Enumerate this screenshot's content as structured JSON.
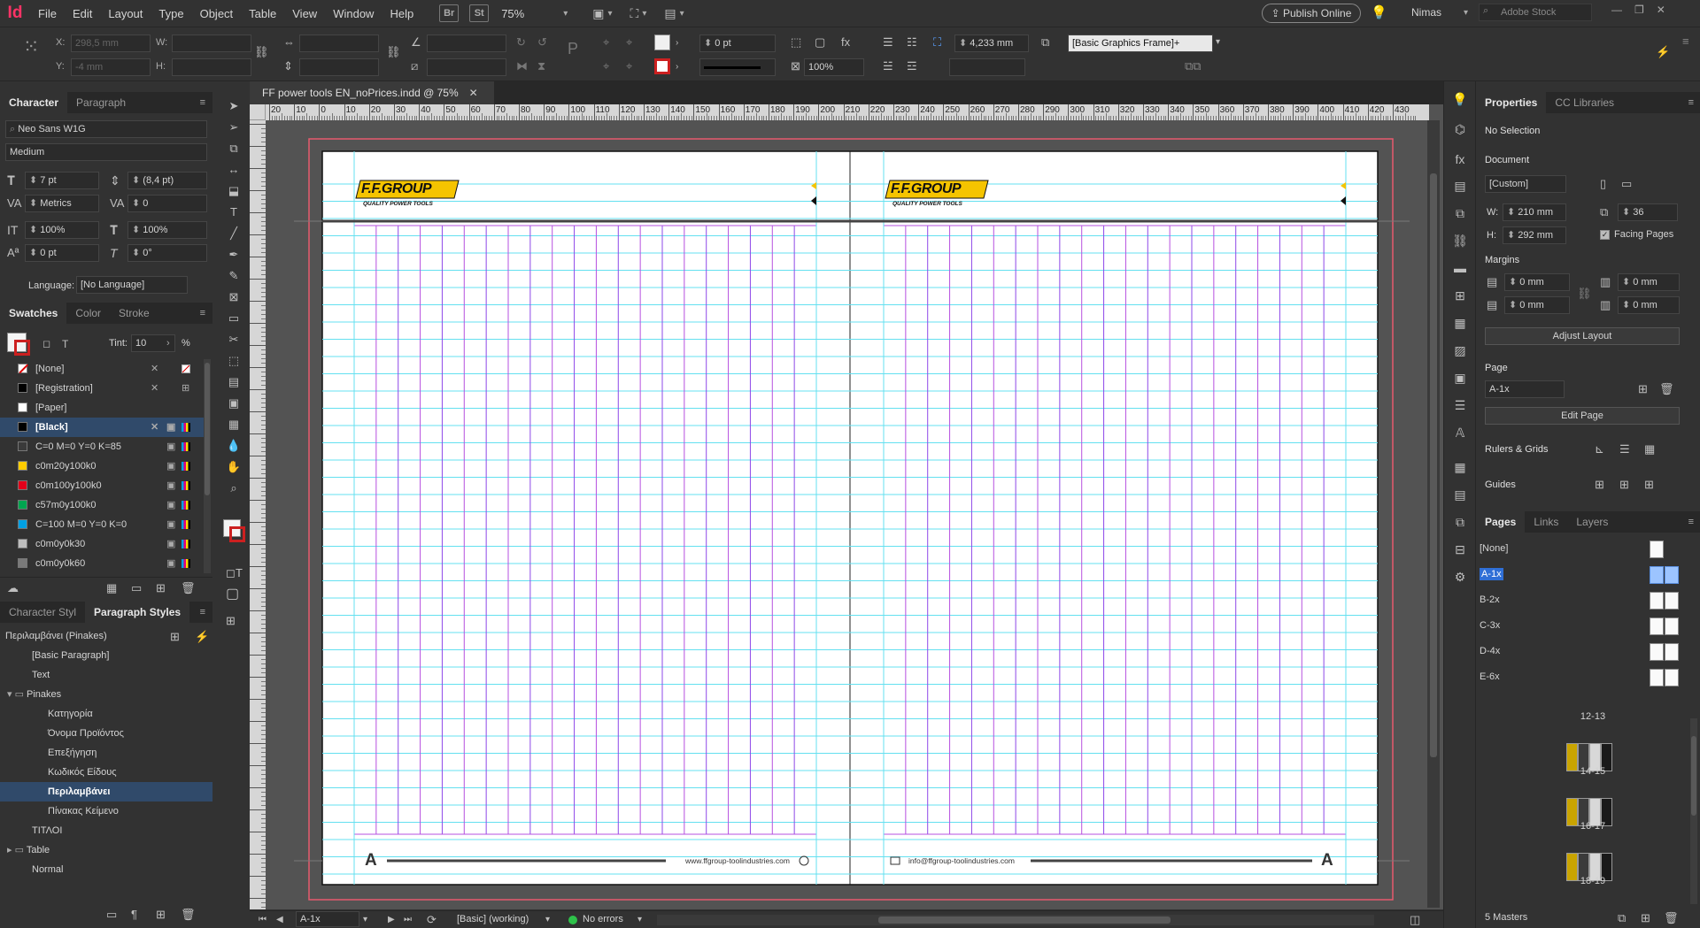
{
  "menu": {
    "app_logo": "Id",
    "items": [
      "File",
      "Edit",
      "Layout",
      "Type",
      "Object",
      "Table",
      "View",
      "Window",
      "Help"
    ],
    "bridge": "Br",
    "stock_app": "St",
    "zoom": "75%",
    "publish": "Publish Online",
    "user": "Nimas",
    "search_placeholder": "Adobe Stock"
  },
  "control": {
    "x_label": "X:",
    "x_value": "298,5 mm",
    "y_label": "Y:",
    "y_value": "-4 mm",
    "w_label": "W:",
    "h_label": "H:",
    "stroke_weight": "0 pt",
    "scale_pct": "100%",
    "frame_dim": "4,233 mm",
    "object_style": "[Basic Graphics Frame]+"
  },
  "character_panel": {
    "tabs": [
      "Character",
      "Paragraph"
    ],
    "font_family": "Neo Sans W1G",
    "font_style": "Medium",
    "size": "7 pt",
    "leading": "(8,4 pt)",
    "kerning": "Metrics",
    "tracking": "0",
    "vscale": "100%",
    "hscale": "100%",
    "baseline": "0 pt",
    "skew": "0°",
    "language_label": "Language:",
    "language": "[No Language]"
  },
  "swatches_panel": {
    "tabs": [
      "Swatches",
      "Color",
      "Stroke"
    ],
    "tint_label": "Tint:",
    "tint": "10",
    "pct": "%",
    "items": [
      {
        "name": "[None]",
        "color": "#ffffff"
      },
      {
        "name": "[Registration]",
        "color": "#000000"
      },
      {
        "name": "[Paper]",
        "color": "#ffffff"
      },
      {
        "name": "[Black]",
        "color": "#000000"
      },
      {
        "name": "C=0 M=0 Y=0 K=85",
        "color": "#3a3a3a"
      },
      {
        "name": "c0m20y100k0",
        "color": "#ffcc00"
      },
      {
        "name": "c0m100y100k0",
        "color": "#e2001a"
      },
      {
        "name": "c57m0y100k0",
        "color": "#00a650"
      },
      {
        "name": "C=100 M=0 Y=0 K=0",
        "color": "#00a0e3"
      },
      {
        "name": "c0m0y0k30",
        "color": "#bdbdbd"
      },
      {
        "name": "c0m0y0k60",
        "color": "#7a7a7a"
      }
    ]
  },
  "styles_panel": {
    "tabs": [
      "Character Styl",
      "Paragraph Styles"
    ],
    "current": "Περιλαμβάνει (Pinakes)",
    "items": [
      {
        "name": "[Basic Paragraph]",
        "indent": 1
      },
      {
        "name": "Text",
        "indent": 1
      },
      {
        "name": "Pinakes",
        "indent": 0,
        "folder": true
      },
      {
        "name": "Κατηγορία",
        "indent": 2
      },
      {
        "name": "Όνομα Προϊόντος",
        "indent": 2
      },
      {
        "name": "Επεξήγηση",
        "indent": 2
      },
      {
        "name": "Κωδικός Είδους",
        "indent": 2
      },
      {
        "name": "Περιλαμβάνει",
        "indent": 2,
        "selected": true
      },
      {
        "name": "Πίνακας Κείμενο",
        "indent": 2
      },
      {
        "name": "ΤΙΤΛΟΙ",
        "indent": 1
      },
      {
        "name": "Table",
        "indent": 0,
        "folder": true
      },
      {
        "name": "Normal",
        "indent": 1
      }
    ]
  },
  "document": {
    "tab_title": "FF power tools EN_noPrices.indd @ 75%",
    "ruler_ticks": [
      "20",
      "10",
      "0",
      "10",
      "20",
      "30",
      "40",
      "50",
      "60",
      "70",
      "80",
      "90",
      "100",
      "110",
      "120",
      "130",
      "140",
      "150",
      "160",
      "170",
      "180",
      "190",
      "200",
      "210",
      "220",
      "230",
      "240",
      "250",
      "260",
      "270",
      "280",
      "290",
      "300",
      "310",
      "320",
      "330",
      "340",
      "350",
      "360",
      "370",
      "380",
      "390",
      "400",
      "410",
      "420",
      "430"
    ],
    "logo_text": "F.F.GROUP",
    "logo_tagline": "QUALITY POWER TOOLS",
    "master_letter": "A",
    "footer_left": "www.ffgroup-toolindustries.com",
    "footer_right": "info@ffgroup-toolindustries.com"
  },
  "status": {
    "page": "A-1x",
    "preflight_profile": "[Basic] (working)",
    "errors": "No errors"
  },
  "properties_panel": {
    "tabs": [
      "Properties",
      "CC Libraries"
    ],
    "selection": "No Selection",
    "document_label": "Document",
    "preset": "[Custom]",
    "w_label": "W:",
    "w_value": "210 mm",
    "h_label": "H:",
    "h_value": "292 mm",
    "pages_count": "36",
    "facing_pages": "Facing Pages",
    "margins_label": "Margins",
    "m_top": "0 mm",
    "m_bottom": "0 mm",
    "m_left": "0 mm",
    "m_right": "0 mm",
    "adjust_layout": "Adjust Layout",
    "page_label": "Page",
    "page_value": "A-1x",
    "edit_page": "Edit Page",
    "rulers_grids": "Rulers & Grids",
    "guides": "Guides"
  },
  "pages_panel": {
    "tabs": [
      "Pages",
      "Links",
      "Layers"
    ],
    "masters": [
      "[None]",
      "A-1x",
      "B-2x",
      "C-3x",
      "D-4x",
      "E-6x"
    ],
    "spreads": [
      "12-13",
      "14-15",
      "16-17",
      "18-19"
    ],
    "footer": "5 Masters"
  }
}
